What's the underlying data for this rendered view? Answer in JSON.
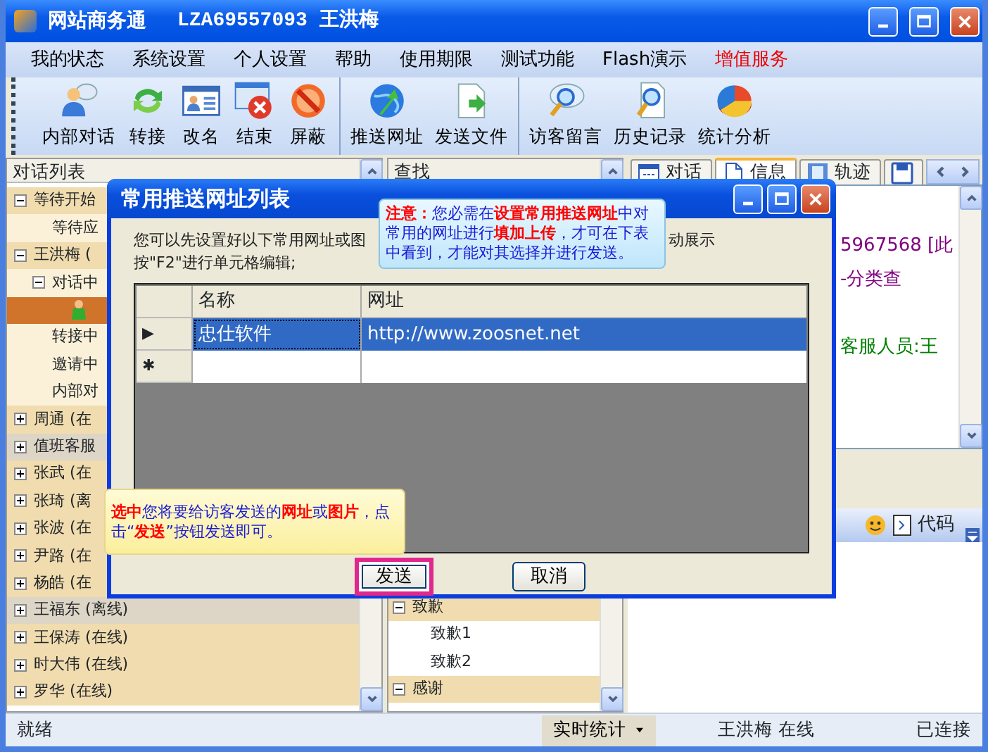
{
  "window": {
    "title": "网站商务通",
    "account": "LZA69557093 王洪梅"
  },
  "menu": [
    {
      "label": "我的状态",
      "highlighted": false
    },
    {
      "label": "系统设置",
      "highlighted": false
    },
    {
      "label": "个人设置",
      "highlighted": false
    },
    {
      "label": "帮助",
      "highlighted": false
    },
    {
      "label": "使用期限",
      "highlighted": false
    },
    {
      "label": "测试功能",
      "highlighted": false
    },
    {
      "label": "Flash演示",
      "highlighted": false
    },
    {
      "label": "增值服务",
      "highlighted": true
    }
  ],
  "toolbar": [
    [
      {
        "label": "内部对话"
      },
      {
        "label": "转接"
      },
      {
        "label": "改名"
      },
      {
        "label": "结束"
      },
      {
        "label": "屏蔽"
      }
    ],
    [
      {
        "label": "推送网址"
      },
      {
        "label": "发送文件"
      }
    ],
    [
      {
        "label": "访客留言"
      },
      {
        "label": "历史记录"
      },
      {
        "label": "统计分析"
      }
    ]
  ],
  "conversation_panel": {
    "title": "对话列表",
    "tree": [
      {
        "label": "等待开始",
        "kind": "group",
        "expanded": true,
        "selected": false,
        "children": [
          {
            "label": "等待应",
            "kind": "item",
            "selected": false
          }
        ]
      },
      {
        "label": "王洪梅 (",
        "kind": "group",
        "expanded": true,
        "selected": false,
        "children": [
          {
            "label": "对话中",
            "kind": "item",
            "expanded": true,
            "selected": false,
            "children": [
              {
                "kind": "visitor",
                "selected": true
              }
            ]
          },
          {
            "label": "转接中",
            "kind": "item",
            "selected": false
          },
          {
            "label": "邀请中",
            "kind": "item",
            "selected": false
          },
          {
            "label": "内部对",
            "kind": "item",
            "selected": false
          }
        ]
      },
      {
        "label": "周通 (在",
        "kind": "group",
        "expanded": false,
        "selected": false
      },
      {
        "label": "值班客服",
        "kind": "muted",
        "expanded": false,
        "selected": false
      },
      {
        "label": "张武 (在",
        "kind": "group",
        "expanded": false,
        "selected": false
      },
      {
        "label": "张琦 (离",
        "kind": "group",
        "expanded": false,
        "selected": false
      },
      {
        "label": "张波 (在",
        "kind": "group",
        "expanded": false,
        "selected": false
      },
      {
        "label": "尹路 (在",
        "kind": "group",
        "expanded": false,
        "selected": false
      },
      {
        "label": "杨皓 (在",
        "kind": "group",
        "expanded": false,
        "selected": false
      },
      {
        "label": "王福东 (离线)",
        "kind": "muted",
        "expanded": false,
        "selected": false
      },
      {
        "label": "王保涛 (在线)",
        "kind": "group",
        "expanded": false,
        "selected": false
      },
      {
        "label": "时大伟 (在线)",
        "kind": "group",
        "expanded": false,
        "selected": false
      },
      {
        "label": "罗华 (在线)",
        "kind": "group",
        "expanded": false,
        "selected": false
      }
    ]
  },
  "search_panel": {
    "title": "查找",
    "tree": [
      {
        "label": "致歉",
        "kind": "group",
        "expanded": true,
        "selected": false,
        "children": [
          {
            "label": "致歉1",
            "kind": "leaf",
            "selected": false
          },
          {
            "label": "致歉2",
            "kind": "leaf",
            "selected": false
          }
        ]
      },
      {
        "label": "感谢",
        "kind": "group",
        "expanded": true,
        "selected": false
      }
    ]
  },
  "info_panel": {
    "tabs": [
      {
        "label": "对话",
        "selected": false
      },
      {
        "label": "信息",
        "selected": true
      },
      {
        "label": "轨迹",
        "selected": false
      },
      {
        "selected": false
      }
    ],
    "lines": [
      {
        "text": "5967568 [此",
        "color": "#800080"
      },
      {
        "text": "-分类查",
        "color": "#800080"
      },
      {
        "text": "客服人员:王",
        "color": "#008000"
      }
    ],
    "input_toolbar": {
      "label": "代码"
    }
  },
  "dialog": {
    "title": "常用推送网址列表",
    "intro": [
      "您可以先设置好以下常用网址或图",
      "动展示"
    ],
    "hint": "按\"F2\"进行单元格编辑;",
    "columns": [
      "名称",
      "网址"
    ],
    "rows": [
      {
        "marker": "▶",
        "cells": [
          "忠仕软件",
          "http://www.zoosnet.net"
        ],
        "selected": true
      },
      {
        "marker": "✱",
        "selected": false
      }
    ],
    "buttons": [
      {
        "label": "发送",
        "highlighted": true
      },
      {
        "label": "取消",
        "highlighted": false
      }
    ]
  },
  "callouts": [
    {
      "kind": "note",
      "text": "**注意：**您必需在**设置常用推送网址**中对常用的网址进行**填加上传**，才可在下表中看到，才能对其选择并进行发送。"
    },
    {
      "kind": "tip",
      "text": "**选中**您将要给访客发送的**网址**或**图片**，点击“**发送**”按钮发送即可。"
    }
  ],
  "status_bar": [
    {
      "label": "就绪",
      "kind": "text"
    },
    {
      "label": "实时统计",
      "kind": "dropdown"
    },
    {
      "label": "王洪梅 在线",
      "kind": "text"
    },
    {
      "label": "已连接",
      "kind": "text"
    }
  ]
}
